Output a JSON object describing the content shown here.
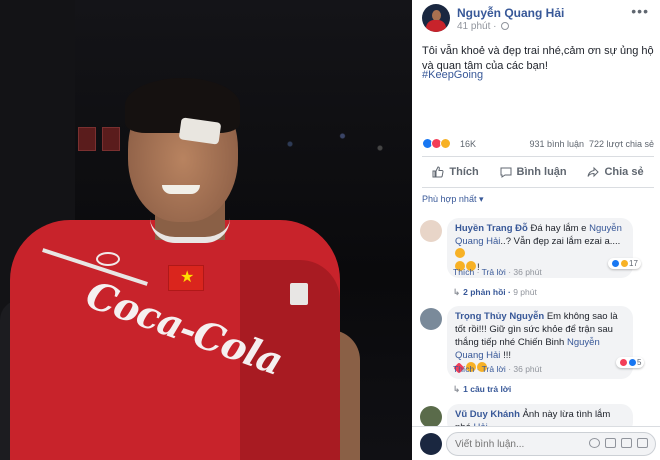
{
  "photo": {
    "shirt_text": "Coca-Cola"
  },
  "post": {
    "author": "Nguyễn Quang Hải",
    "time": "41 phút",
    "text": "Tôi vẫn khoẻ và đẹp trai nhé,cảm ơn sự ủng hộ và quan tâm của các bạn!",
    "hashtag": "#KeepGoing",
    "reaction_count": "16K",
    "comment_count": "931 bình luận",
    "share_count": "722 lượt chia sẻ",
    "actions": {
      "like": "Thích",
      "comment": "Bình luận",
      "share": "Chia sẻ"
    },
    "sort_label": "Phù hợp nhất"
  },
  "comments": [
    {
      "name": "Huyền Trang Đỗ",
      "text_before": "Đá hay lắm e",
      "mention": "Nguyễn Quang Hải",
      "text_after": "..? Vẫn đẹp zai lắm ezai a....",
      "extra": "!",
      "like_label": "Thích",
      "reply_label": "Trả lời",
      "time": "36 phút",
      "react_count": "17",
      "replies": "2 phản hồi",
      "replies_time": "9 phút"
    },
    {
      "name": "Trọng Thủy Nguyễn",
      "text_before": "Em không sao là tốt rồi!!! Giữ gìn sức khỏe để trận sau thắng tiếp nhé Chiến Binh",
      "mention": "Nguyễn Quang Hải",
      "text_after": "!!!",
      "like_label": "Thích",
      "reply_label": "Trả lời",
      "time": "36 phút",
      "react_count": "5",
      "replies": "1 câu trả lời"
    },
    {
      "name": "Vũ Duy Khánh",
      "text_before": "Ảnh này lừa tình lắm nhé",
      "mention": "Hải"
    }
  ],
  "compose": {
    "placeholder": "Viết bình luận..."
  },
  "colors": {
    "link": "#385898",
    "meta": "#90949c",
    "bubble": "#f2f3f5",
    "like_blue": "#1877f2",
    "love_red": "#f33e58",
    "haha_yellow": "#f7b125"
  },
  "icons": [
    "more-icon",
    "globe-icon",
    "like-icon",
    "comment-icon",
    "share-icon",
    "camera-icon",
    "gif-icon",
    "sticker-icon",
    "emoji-icon"
  ]
}
